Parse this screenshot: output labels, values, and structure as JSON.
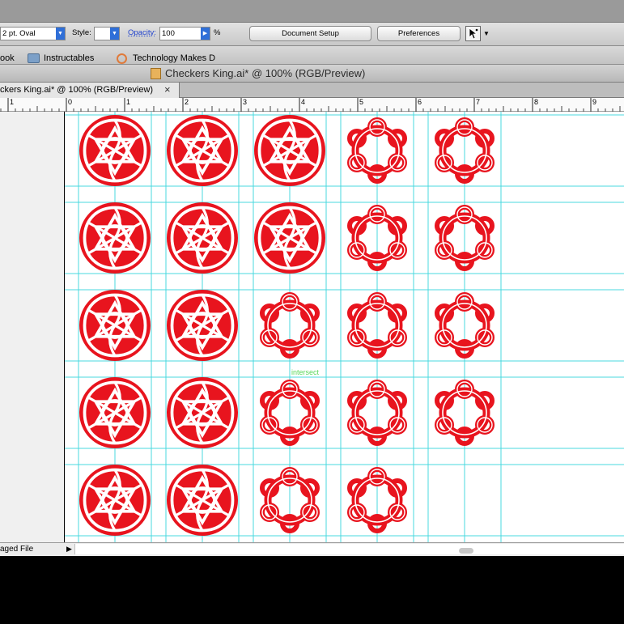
{
  "control_bar": {
    "brush_value": "2 pt. Oval",
    "style_label": "Style:",
    "style_value": "",
    "opacity_label": "Opacity:",
    "opacity_value": "100",
    "opacity_unit": "%",
    "document_setup_label": "Document Setup",
    "preferences_label": "Preferences",
    "arrow_glyph": "▼",
    "right_arrow_glyph": "▶"
  },
  "bookmarks": {
    "items": [
      {
        "label": "ook"
      },
      {
        "label": "Instructables"
      },
      {
        "label": "Technology Makes D"
      }
    ]
  },
  "window": {
    "title": "Checkers King.ai* @ 100% (RGB/Preview)"
  },
  "tab": {
    "label": "ckers King.ai* @ 100% (RGB/Preview)",
    "close_glyph": "×"
  },
  "ruler": {
    "labels": [
      "1",
      "0",
      "1",
      "2",
      "3",
      "4",
      "5",
      "6",
      "7",
      "8",
      "9"
    ]
  },
  "canvas": {
    "smart_guide_label": "intersect",
    "accent_color": "#e8141e",
    "guide_color": "#48d9df",
    "grid": {
      "rows": 5,
      "columns": 5,
      "cells": [
        [
          "disc",
          "disc",
          "disc",
          "ring",
          "ring"
        ],
        [
          "disc",
          "disc",
          "disc",
          "ring",
          "ring"
        ],
        [
          "disc",
          "disc",
          "ring",
          "ring",
          "ring"
        ],
        [
          "disc",
          "disc",
          "ring",
          "ring",
          "ring"
        ],
        [
          "disc",
          "disc",
          "ring",
          "ring",
          ""
        ]
      ]
    }
  },
  "status_bar": {
    "text": "aged File",
    "arrow_glyph": "▶"
  }
}
